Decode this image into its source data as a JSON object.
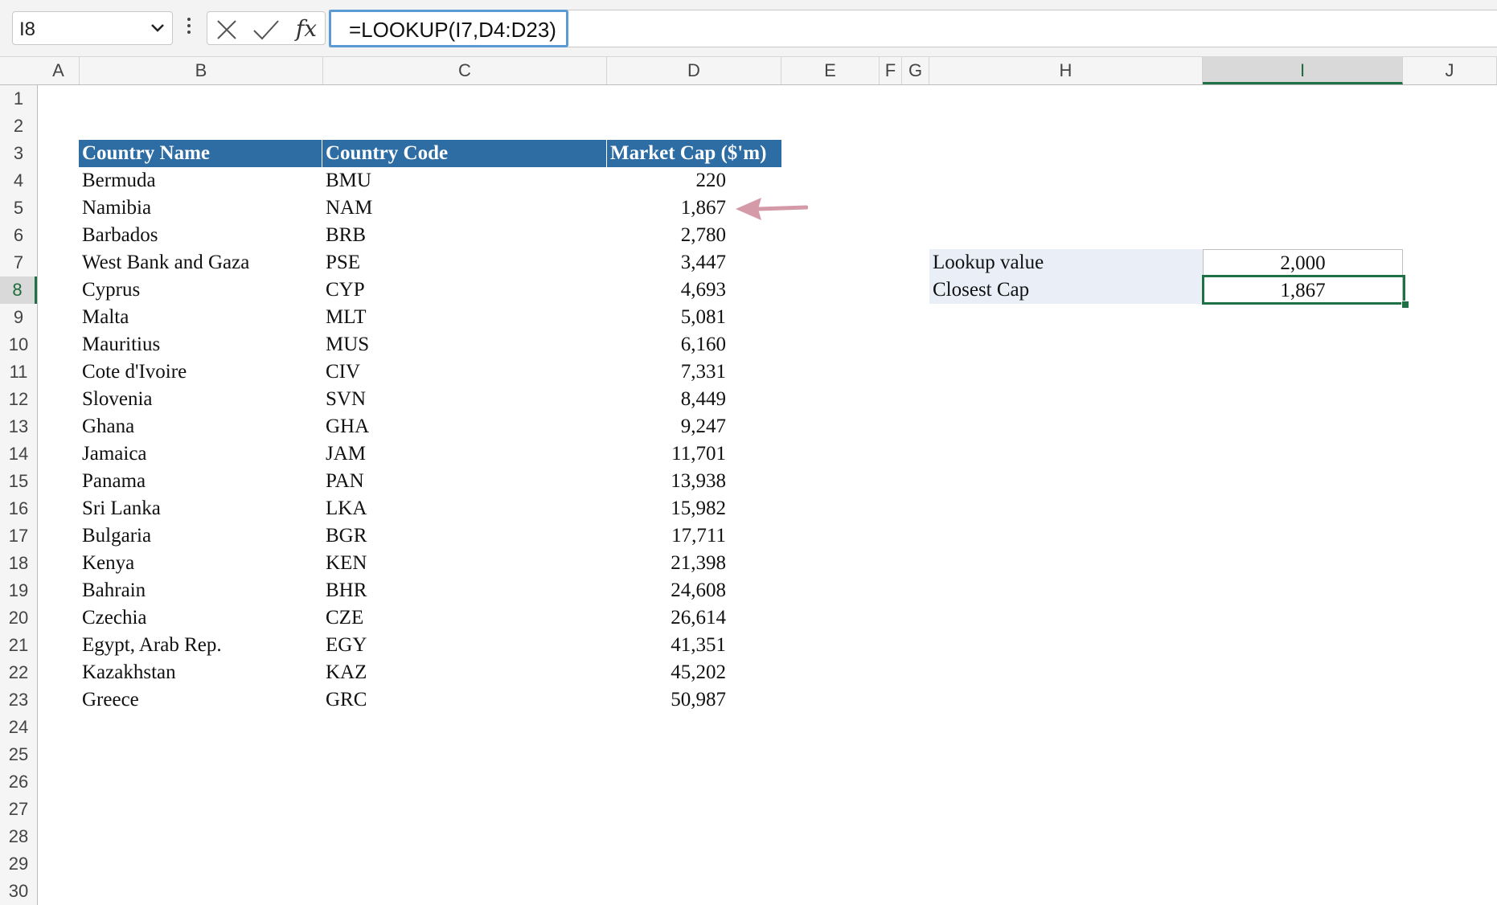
{
  "formula_bar": {
    "name_box": "I8",
    "formula": "=LOOKUP(I7,D4:D23)",
    "fx_label": "fx"
  },
  "columns": [
    "A",
    "B",
    "C",
    "D",
    "E",
    "F",
    "G",
    "H",
    "I",
    "J"
  ],
  "rows": [
    "1",
    "2",
    "3",
    "4",
    "5",
    "6",
    "7",
    "8",
    "9",
    "10",
    "11",
    "12",
    "13",
    "14",
    "15",
    "16",
    "17",
    "18",
    "19",
    "20",
    "21",
    "22",
    "23",
    "24",
    "25",
    "26",
    "27",
    "28",
    "29",
    "30"
  ],
  "table": {
    "headers": [
      "Country Name",
      "Country Code",
      "Market Cap ($'m)"
    ],
    "rows": [
      [
        "Bermuda",
        "BMU",
        "220"
      ],
      [
        "Namibia",
        "NAM",
        "1,867"
      ],
      [
        "Barbados",
        "BRB",
        "2,780"
      ],
      [
        "West Bank and Gaza",
        "PSE",
        "3,447"
      ],
      [
        "Cyprus",
        "CYP",
        "4,693"
      ],
      [
        "Malta",
        "MLT",
        "5,081"
      ],
      [
        "Mauritius",
        "MUS",
        "6,160"
      ],
      [
        "Cote d'Ivoire",
        "CIV",
        "7,331"
      ],
      [
        "Slovenia",
        "SVN",
        "8,449"
      ],
      [
        "Ghana",
        "GHA",
        "9,247"
      ],
      [
        "Jamaica",
        "JAM",
        "11,701"
      ],
      [
        "Panama",
        "PAN",
        "13,938"
      ],
      [
        "Sri Lanka",
        "LKA",
        "15,982"
      ],
      [
        "Bulgaria",
        "BGR",
        "17,711"
      ],
      [
        "Kenya",
        "KEN",
        "21,398"
      ],
      [
        "Bahrain",
        "BHR",
        "24,608"
      ],
      [
        "Czechia",
        "CZE",
        "26,614"
      ],
      [
        "Egypt, Arab Rep.",
        "EGY",
        "41,351"
      ],
      [
        "Kazakhstan",
        "KAZ",
        "45,202"
      ],
      [
        "Greece",
        "GRC",
        "50,987"
      ]
    ]
  },
  "lookup": {
    "label1": "Lookup value",
    "value1": "2,000",
    "label2": "Closest Cap",
    "value2": "1,867"
  },
  "colors": {
    "header_fill": "#2e6ca4",
    "label_fill": "#e9eef7",
    "selection": "#1e7145",
    "arrow": "#d49aa8"
  }
}
